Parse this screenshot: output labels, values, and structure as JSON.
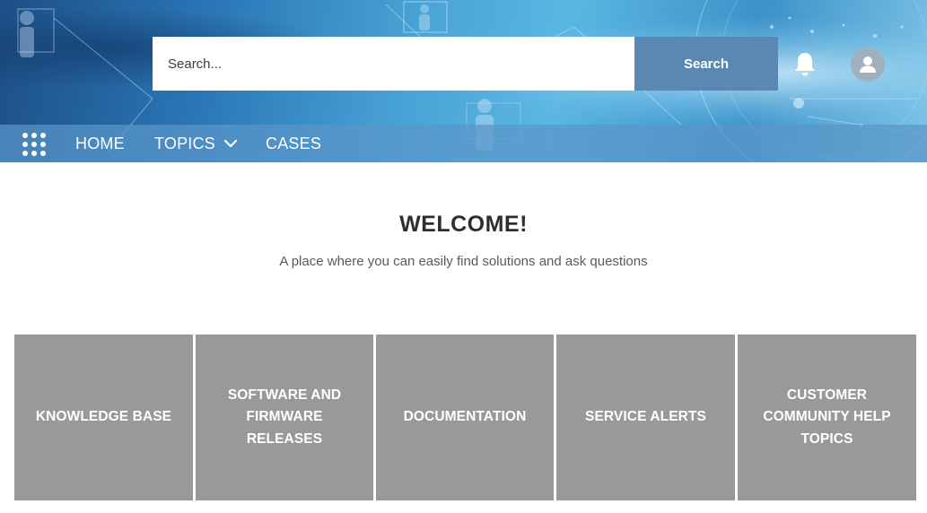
{
  "header": {
    "search": {
      "placeholder": "Search...",
      "button_label": "Search"
    },
    "icons": {
      "notifications": "bell-icon",
      "profile": "user-avatar-icon"
    }
  },
  "nav": {
    "menu_icon": "app-launcher-icon",
    "items": [
      {
        "label": "HOME"
      },
      {
        "label": "TOPICS",
        "has_dropdown": true
      },
      {
        "label": "CASES"
      }
    ]
  },
  "welcome": {
    "title": "WELCOME!",
    "subtitle": "A place where you can easily find solutions and ask questions"
  },
  "tiles": [
    {
      "label": "KNOWLEDGE BASE"
    },
    {
      "label": "SOFTWARE AND FIRMWARE RELEASES"
    },
    {
      "label": "DOCUMENTATION"
    },
    {
      "label": "SERVICE ALERTS"
    },
    {
      "label": "CUSTOMER COMMUNITY HELP TOPICS"
    }
  ],
  "colors": {
    "search_button": "#5a88b3",
    "navbar": "#5a96c8",
    "tile": "#999999",
    "title_text": "#2e2e2e"
  }
}
